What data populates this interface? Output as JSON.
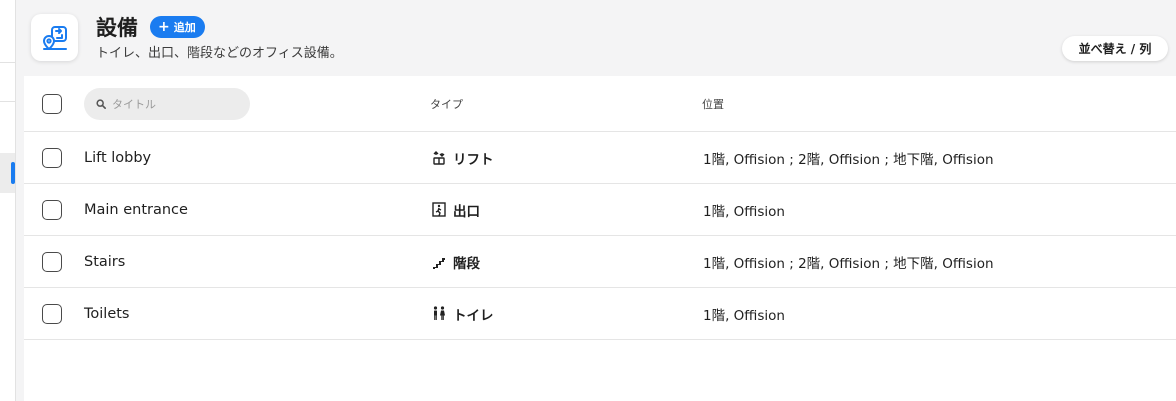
{
  "header": {
    "title": "設備",
    "add_label": "追加",
    "subtitle": "トイレ、出口、階段などのオフィス設備。",
    "sort_label": "並べ替え / 列"
  },
  "table": {
    "search_placeholder": "タイトル",
    "columns": {
      "type": "タイプ",
      "location": "位置"
    },
    "rows": [
      {
        "title": "Lift lobby",
        "type": "リフト",
        "type_icon": "lift-icon",
        "location": "1階, Offision ; 2階, Offision ; 地下階, Offision"
      },
      {
        "title": "Main entrance",
        "type": "出口",
        "type_icon": "exit-icon",
        "location": "1階, Offision"
      },
      {
        "title": "Stairs",
        "type": "階段",
        "type_icon": "stairs-icon",
        "location": "1階, Offision ; 2階, Offision ; 地下階, Offision"
      },
      {
        "title": "Toilets",
        "type": "トイレ",
        "type_icon": "toilet-icon",
        "location": "1階, Offision"
      }
    ]
  },
  "colors": {
    "accent": "#1a7cf0",
    "background": "#f4f4f5",
    "panel": "#ffffff"
  },
  "icons": {
    "app": "facility-map-icon",
    "search": "search-icon"
  }
}
